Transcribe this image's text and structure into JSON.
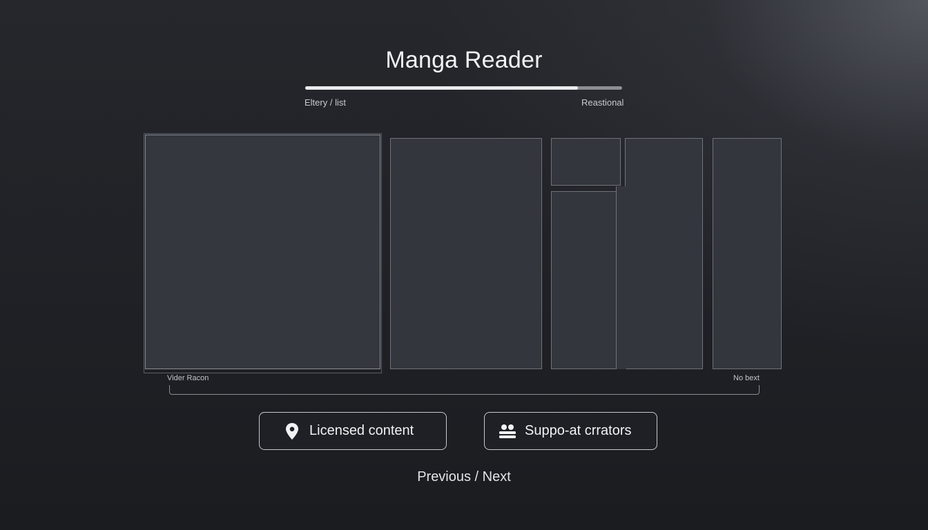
{
  "header": {
    "title": "Manga Reader"
  },
  "progress": {
    "value": 0.86,
    "left_label": "Eltery / list",
    "right_label": "Reastional"
  },
  "panels": {
    "nav_prev_label": "Vider Racon",
    "nav_next_label": "No bext"
  },
  "actions": {
    "licensed_label": "Licensed content",
    "licensed_icon": "location-pin-icon",
    "support_label": "Suppo-at crrators",
    "support_icon": "users-icon"
  },
  "footer": {
    "pager_label": "Previous / Next"
  },
  "colors": {
    "background": "#1f2126",
    "panel": "#33363c",
    "progress_fill": "#e9eaec",
    "progress_track": "#8b8e94"
  }
}
